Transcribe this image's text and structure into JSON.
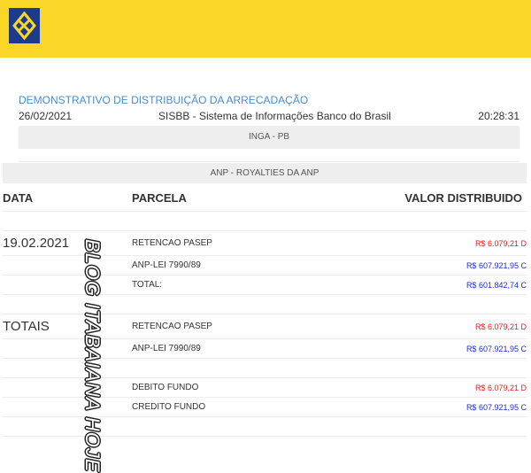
{
  "header": {
    "logo_icon": "banco-do-brasil-logo-icon",
    "bar_color": "#fad628"
  },
  "document": {
    "title": "DEMONSTRATIVO DE DISTRIBUIÇÃO DA ARRECADAÇÃO",
    "date": "26/02/2021",
    "system": "SISBB - Sistema de Informações Banco do Brasil",
    "time": "20:28:31",
    "municipality": "INGA - PB",
    "fund": "ANP - ROYALTIES DA ANP"
  },
  "table": {
    "columns": {
      "date": "DATA",
      "parcela": "PARCELA",
      "valor": "VALOR DISTRIBUIDO"
    },
    "rows": [
      {
        "date": "",
        "parcela": "",
        "valor": ""
      },
      {
        "date": "19.02.2021",
        "parcela": "RETENCAO PASEP",
        "valor": "R$ 6.079,21 D"
      },
      {
        "date": "",
        "parcela": "ANP-LEI 7990/89",
        "valor": "R$ 607.921,95 C"
      },
      {
        "date": "",
        "parcela": "TOTAL:",
        "valor": "R$ 601.842,74 C"
      },
      {
        "date": "",
        "parcela": "",
        "valor": ""
      },
      {
        "date": "TOTAIS",
        "parcela": "RETENCAO PASEP",
        "valor": "R$ 6.079,21 D"
      },
      {
        "date": "",
        "parcela": "ANP-LEI 7990/89",
        "valor": "R$ 607.921,95 C"
      },
      {
        "date": "",
        "parcela": "",
        "valor": ""
      },
      {
        "date": "",
        "parcela": "DEBITO FUNDO",
        "valor": "R$ 6.079,21 D"
      },
      {
        "date": "",
        "parcela": "CREDITO FUNDO",
        "valor": "R$ 607.921,95 C"
      },
      {
        "date": "",
        "parcela": "",
        "valor": ""
      }
    ]
  },
  "watermark": {
    "text": "BLOG ITABAIANA HOJE"
  },
  "colors": {
    "debit": "#e02020",
    "credit": "#1a2fd0",
    "title": "#4a8dc7"
  }
}
